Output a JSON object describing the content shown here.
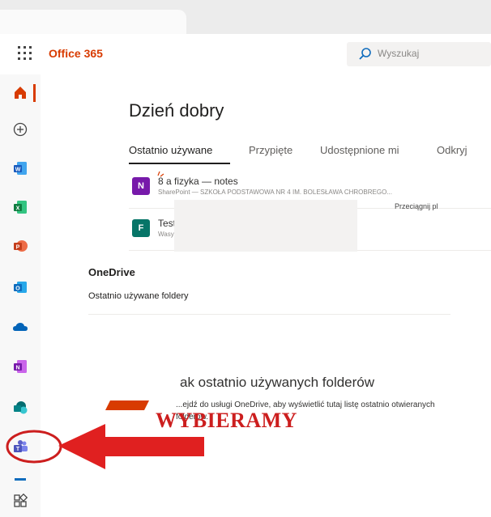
{
  "header": {
    "brand": "Office 365",
    "search_placeholder": "Wyszukaj"
  },
  "rail": {
    "apps": [
      "home-icon",
      "create-icon",
      "word-icon",
      "excel-icon",
      "powerpoint-icon",
      "outlook-icon",
      "onedrive-icon",
      "onenote-icon",
      "sharepoint-icon",
      "teams-icon",
      "all-apps-icon"
    ]
  },
  "main": {
    "greeting": "Dzień dobry",
    "tabs": [
      {
        "label": "Ostatnio używane"
      },
      {
        "label": "Przypięte"
      },
      {
        "label": "Udostępnione mi"
      },
      {
        "label": "Odkryj"
      }
    ],
    "files": [
      {
        "name": "8 a fizyka — notes",
        "location": "SharePoint — SZKOŁA PODSTAWOWA NR 4 IM. BOLESŁAWA CHROBREGO...",
        "icon_letter": "N",
        "icon_color": "#7719aa"
      },
      {
        "name": "Test bez tytułu",
        "location": "Wasylinka Roksana",
        "icon_letter": "F",
        "icon_color": "#077568"
      }
    ],
    "drag_text": "Przeciągnij pl",
    "onedrive": {
      "title": "OneDrive",
      "subtitle": "Ostatnio używane foldery",
      "empty_title": "ak ostatnio używanych folderów",
      "empty_desc": "...ejdź do usługi OneDrive, aby wyświetlić tutaj listę ostatnio otwieranych folderów."
    }
  },
  "annotation": {
    "text": "WYBIERAMY",
    "color": "#cc1e1e"
  },
  "colors": {
    "accent": "#d83b01",
    "word": "#185abd",
    "excel": "#107c41",
    "powerpoint": "#c43e1c",
    "outlook": "#0f6cbd",
    "onedrive": "#0364b8",
    "onenote": "#7719aa",
    "sharepoint": "#038387",
    "teams": "#5b5fc7"
  }
}
